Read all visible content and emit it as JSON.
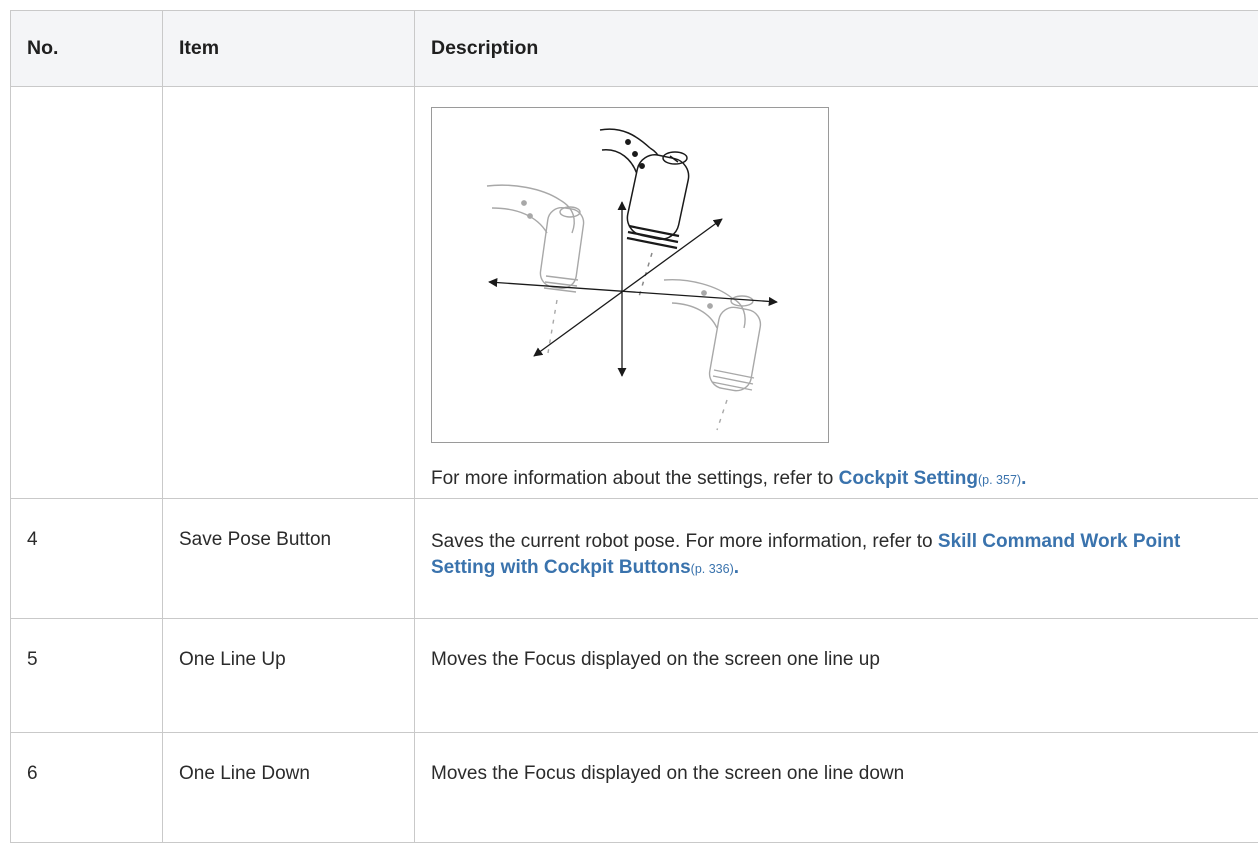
{
  "table": {
    "headers": {
      "no": "No.",
      "item": "Item",
      "description": "Description"
    },
    "figure_row": {
      "caption_prefix": "For more information about the settings, refer to ",
      "link_text": "Cockpit Setting",
      "link_page": "(p. 357)",
      "caption_suffix": "."
    },
    "rows": [
      {
        "no": "4",
        "item": "Save Pose Button",
        "desc_prefix": "Saves the current robot pose. For more information, refer to ",
        "link_text": "Skill Command Work Point Setting with Cockpit Buttons",
        "link_page": "(p. 336)",
        "desc_suffix": "."
      },
      {
        "no": "5",
        "item": "One Line Up",
        "desc": "Moves the Focus displayed on the screen one line up"
      },
      {
        "no": "6",
        "item": "One Line Down",
        "desc": "Moves the Focus displayed on the screen one line down"
      }
    ]
  }
}
